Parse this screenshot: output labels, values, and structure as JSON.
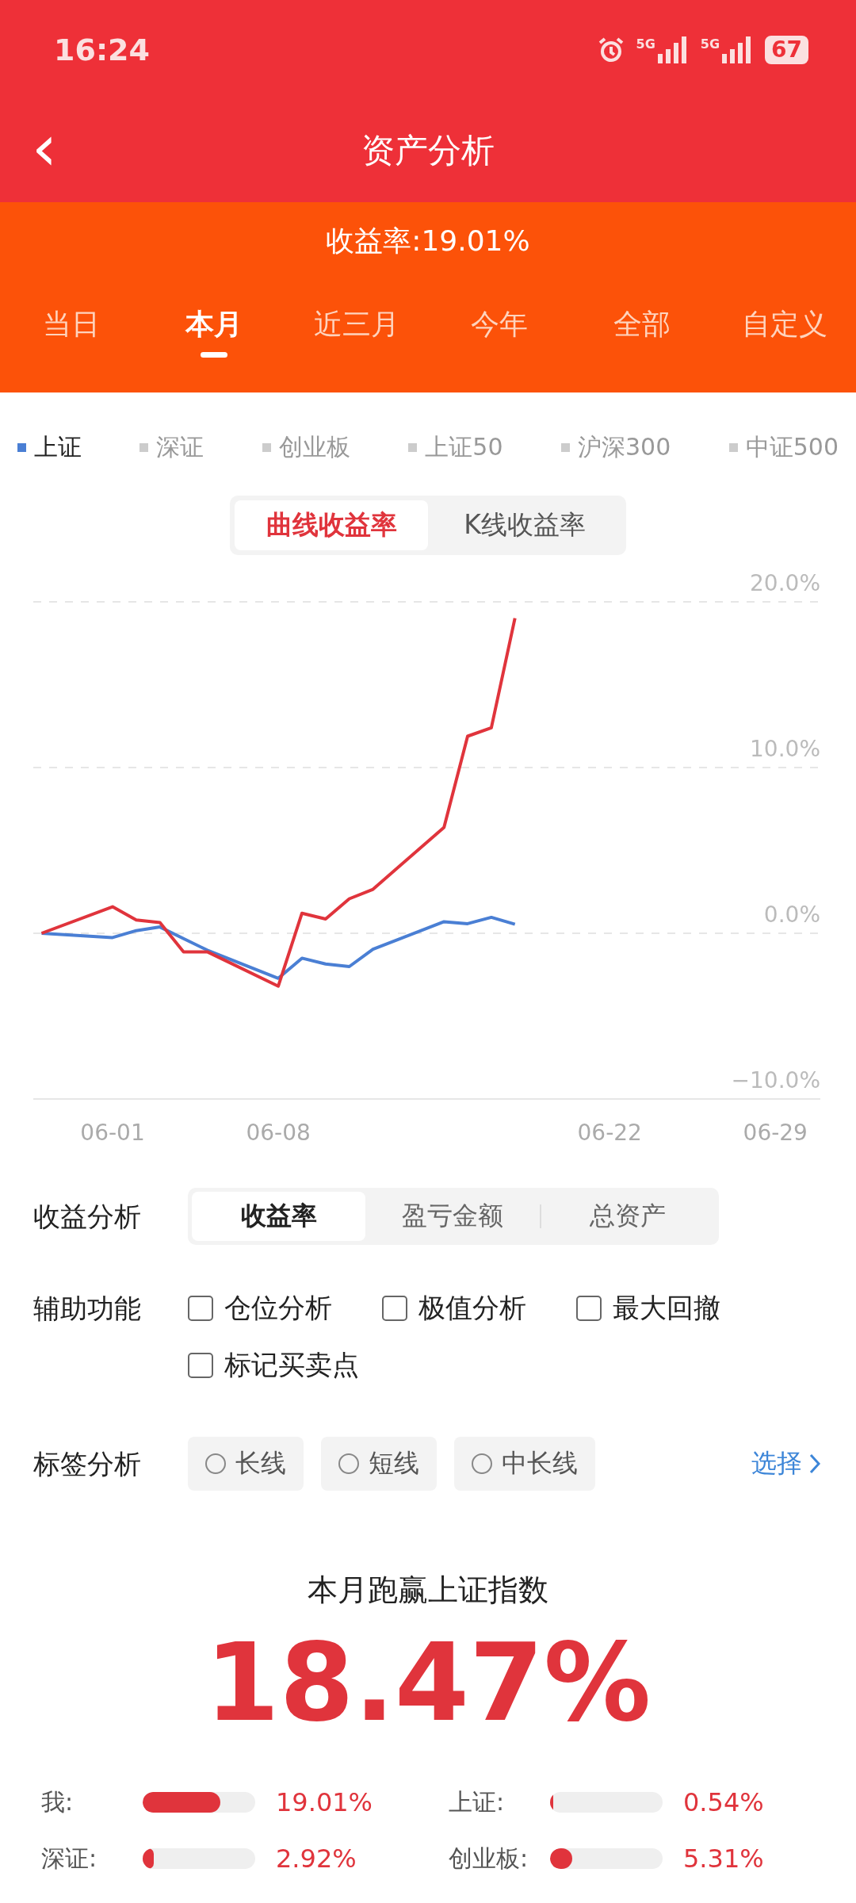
{
  "status_bar": {
    "time": "16:24",
    "networks": [
      "5G",
      "5G"
    ],
    "battery": "67"
  },
  "title_bar": {
    "back": "‹",
    "title": "资产分析"
  },
  "summary": {
    "yield": "收益率:19.01%"
  },
  "period_tabs": [
    {
      "label": "当日",
      "selected": false
    },
    {
      "label": "本月",
      "selected": true
    },
    {
      "label": "近三月",
      "selected": false
    },
    {
      "label": "今年",
      "selected": false
    },
    {
      "label": "全部",
      "selected": false
    },
    {
      "label": "自定义",
      "selected": false
    }
  ],
  "index_legend": [
    {
      "label": "上证",
      "selected": true,
      "color": "#4a7fd4"
    },
    {
      "label": "深证",
      "selected": false,
      "color": "#cccccc"
    },
    {
      "label": "创业板",
      "selected": false,
      "color": "#cccccc"
    },
    {
      "label": "上证50",
      "selected": false,
      "color": "#cccccc"
    },
    {
      "label": "沪深300",
      "selected": false,
      "color": "#cccccc"
    },
    {
      "label": "中证500",
      "selected": false,
      "color": "#cccccc"
    }
  ],
  "chart_toggle": [
    {
      "label": "曲线收益率",
      "selected": true
    },
    {
      "label": "K线收益率",
      "selected": false
    }
  ],
  "chart": {
    "chart_data": {
      "type": "line",
      "categories": [
        null,
        null,
        null,
        "06-01",
        null,
        null,
        null,
        null,
        null,
        null,
        "06-08",
        null,
        null,
        null,
        null,
        null,
        null,
        null,
        null,
        null,
        null,
        null,
        null,
        null,
        "06-22",
        null,
        null,
        null,
        null,
        null,
        null,
        "06-29"
      ],
      "series": [
        {
          "color": "#e0343c",
          "values": [
            0,
            null,
            null,
            1.6,
            0.8,
            0.64,
            -1.12,
            -1.12,
            null,
            null,
            -3.19,
            1.21,
            0.86,
            2.08,
            2.65,
            null,
            null,
            6.39,
            11.89,
            12.4,
            19.01,
            null,
            null,
            null,
            null,
            null,
            null,
            null,
            null,
            null,
            null,
            null
          ]
        },
        {
          "color": "#4a7fd4",
          "values": [
            0,
            null,
            null,
            -0.26,
            0.16,
            0.38,
            -0.32,
            -1.02,
            null,
            null,
            -2.72,
            -1.5,
            -1.85,
            -2.01,
            -0.96,
            null,
            null,
            0.7,
            0.58,
            0.96,
            0.54,
            null,
            null,
            null,
            null,
            null,
            null,
            null,
            null,
            null,
            null,
            null
          ]
        }
      ],
      "ylim": [
        -10,
        20
      ],
      "yticks": [
        {
          "value": 20,
          "label": "20.0%"
        },
        {
          "value": 10,
          "label": "10.0%"
        },
        {
          "value": 0,
          "label": "0.0%"
        },
        {
          "value": -10,
          "label": "−10.0%"
        }
      ]
    }
  },
  "profit_analysis": {
    "label": "收益分析",
    "options": [
      {
        "label": "收益率",
        "selected": true
      },
      {
        "label": "盈亏金额",
        "selected": false
      },
      {
        "label": "总资产",
        "selected": false
      }
    ]
  },
  "aux_functions": {
    "label": "辅助功能",
    "options": [
      {
        "label": "仓位分析",
        "checked": false
      },
      {
        "label": "极值分析",
        "checked": false
      },
      {
        "label": "最大回撤",
        "checked": false
      },
      {
        "label": "标记买卖点",
        "checked": false
      }
    ]
  },
  "tag_analysis": {
    "label": "标签分析",
    "options": [
      {
        "label": "长线",
        "selected": false
      },
      {
        "label": "短线",
        "selected": false
      },
      {
        "label": "中长线",
        "selected": false
      }
    ],
    "select": "选择"
  },
  "comparison": {
    "headline": "本月跑赢上证指数",
    "value": "18.47%",
    "bars": [
      {
        "label": "我:",
        "level": 0.69,
        "value": "19.01%"
      },
      {
        "label": "上证:",
        "level": 0.03,
        "value": "0.54%"
      },
      {
        "label": "深证:",
        "level": 0.1,
        "value": "2.92%"
      },
      {
        "label": "创业板:",
        "level": 0.2,
        "value": "5.31%"
      }
    ]
  }
}
